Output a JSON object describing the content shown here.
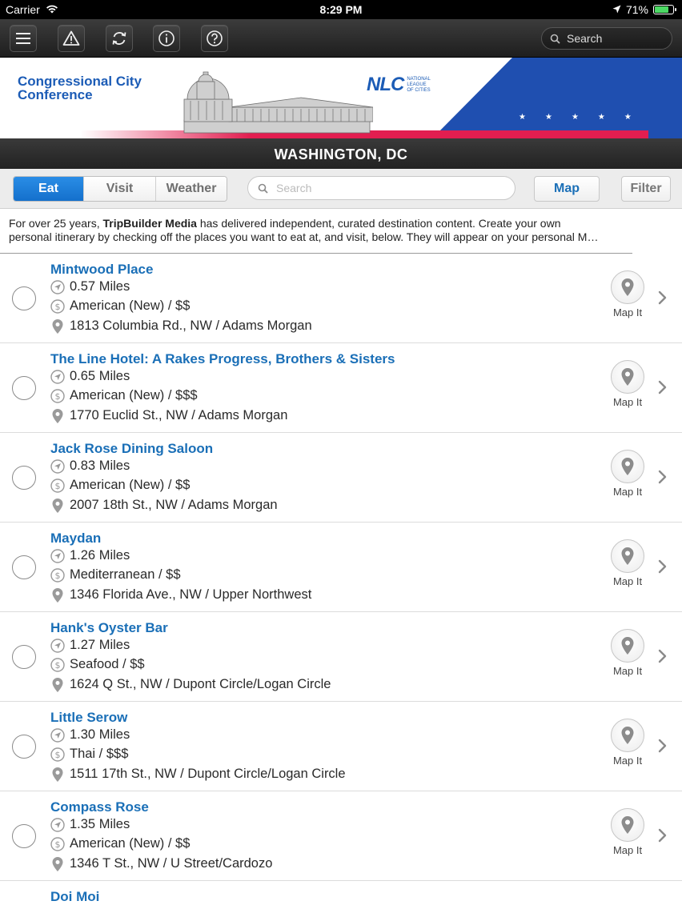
{
  "status_bar": {
    "carrier": "Carrier",
    "time": "8:29 PM",
    "battery": "71%"
  },
  "toolbar": {
    "search_placeholder": "Search"
  },
  "banner": {
    "title_line1": "Congressional City",
    "title_line2": "Conference",
    "logo": "NLC",
    "logo_sub": [
      "NATIONAL",
      "LEAGUE",
      "OF CITIES"
    ]
  },
  "city": "WASHINGTON, DC",
  "tabs": {
    "eat": "Eat",
    "visit": "Visit",
    "weather": "Weather",
    "active": "Eat"
  },
  "search": {
    "placeholder": "Search"
  },
  "buttons": {
    "map": "Map",
    "filter": "Filter"
  },
  "intro": {
    "before": "For over 25 years, ",
    "brand": "TripBuilder Media",
    "after": " has delivered independent, curated destination content. Create your own",
    "line2": "personal itinerary by checking off the places you want to eat at, and visit, below. They will appear on your personal M…"
  },
  "map_it_label": "Map It",
  "places": [
    {
      "name": "Mintwood Place",
      "distance": "0.57 Miles",
      "category": "American (New) / $$",
      "address": "1813 Columbia Rd., NW / Adams Morgan"
    },
    {
      "name": "The Line Hotel:  A Rakes Progress, Brothers & Sisters",
      "distance": "0.65 Miles",
      "category": "American (New) / $$$",
      "address": "1770 Euclid St., NW / Adams Morgan"
    },
    {
      "name": "Jack Rose Dining Saloon",
      "distance": "0.83 Miles",
      "category": "American (New) / $$",
      "address": "2007 18th St., NW / Adams Morgan"
    },
    {
      "name": "Maydan",
      "distance": "1.26 Miles",
      "category": "Mediterranean / $$",
      "address": "1346 Florida Ave., NW / Upper Northwest"
    },
    {
      "name": "Hank's Oyster Bar",
      "distance": "1.27 Miles",
      "category": "Seafood / $$",
      "address": "1624 Q St., NW / Dupont Circle/Logan Circle"
    },
    {
      "name": "Little Serow",
      "distance": "1.30 Miles",
      "category": "Thai / $$$",
      "address": "1511 17th St., NW / Dupont Circle/Logan Circle"
    },
    {
      "name": "Compass Rose",
      "distance": "1.35 Miles",
      "category": "American (New) / $$",
      "address": "1346 T St., NW / U Street/Cardozo"
    },
    {
      "name": "Doi Moi"
    }
  ],
  "colors": {
    "accent": "#1a6fb7",
    "active_tab": "#1470cc",
    "banner_blue": "#1f4fb0",
    "banner_red": "#e21e50"
  }
}
